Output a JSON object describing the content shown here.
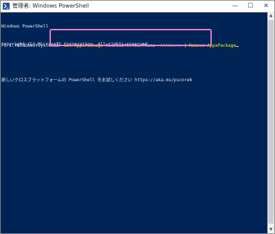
{
  "window": {
    "title": "管理者: Windows PowerShell",
    "min_glyph": "—",
    "max_glyph": "☐",
    "close_glyph": "✕"
  },
  "console": {
    "lines": [
      "Windows PowerShell",
      "Copyright (C) Microsoft Corporation. All rights reserved.",
      "",
      "新しいクロスプラットフォームの PowerShell をお試しください https://aka.ms/pscore6",
      ""
    ],
    "prompt": "PS C:¥WINDOWS¥system32> ",
    "command": {
      "cmdlet1": "Get-AppxPackage",
      "arg1": " Microsoft.YourPhone ",
      "param1": "-AllUsers",
      "pipe": " | ",
      "cmdlet2": "Remove-AppxPackage"
    }
  },
  "scrollbar": {
    "up_glyph": "▲",
    "down_glyph": "▼"
  },
  "colors": {
    "console_background": "#012456",
    "console_text": "#eeedf0",
    "cmdlet": "#ffff00",
    "parameter": "#8a8a8a",
    "highlight_box": "#f080c0"
  }
}
